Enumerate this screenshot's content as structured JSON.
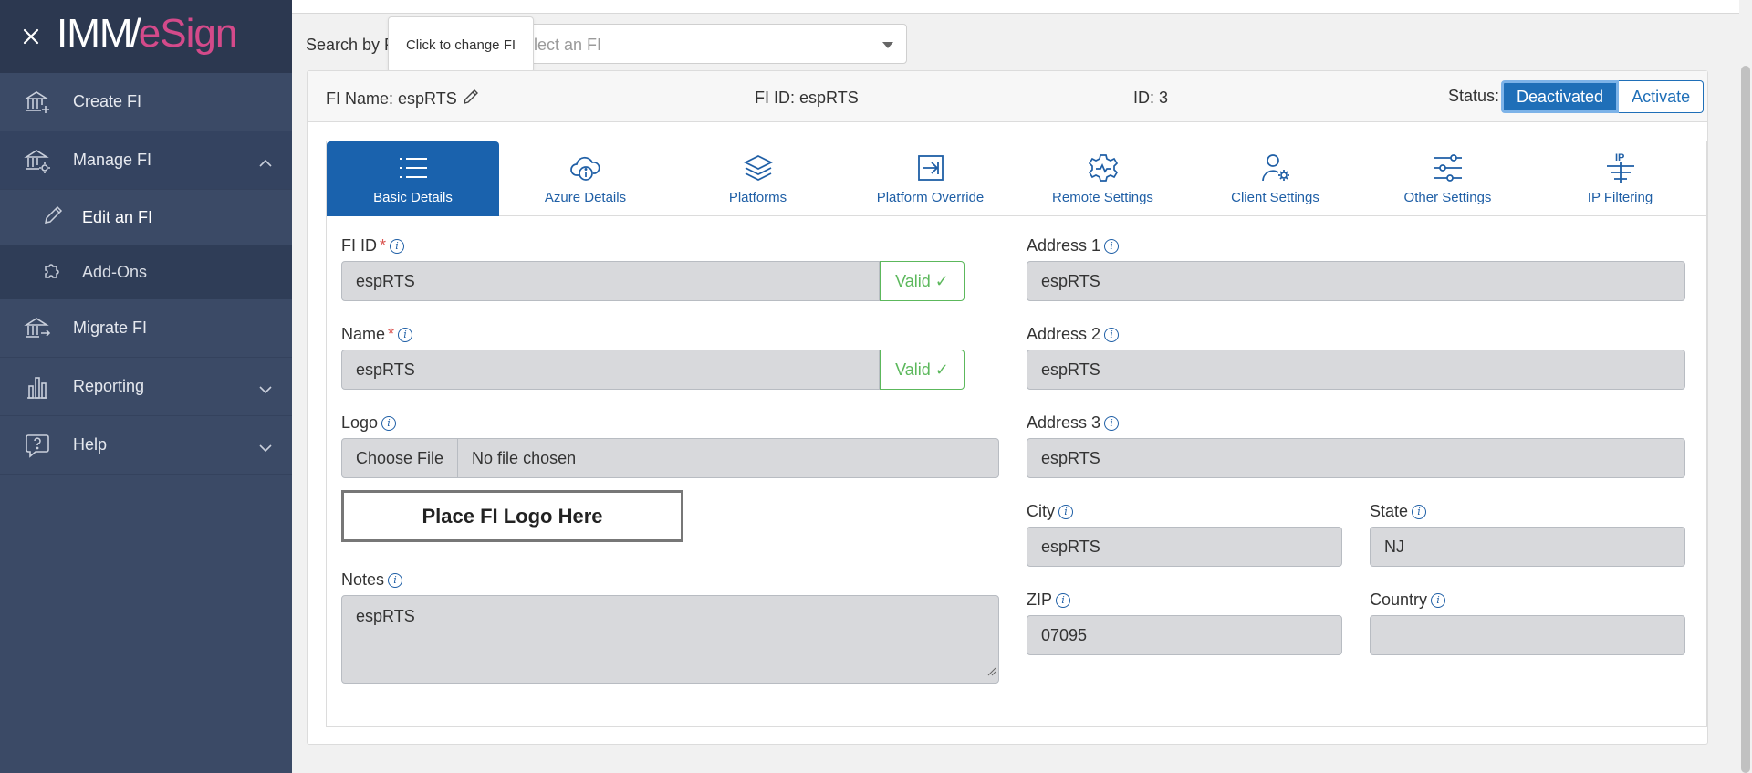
{
  "sidebar": {
    "logo": {
      "part1": "IMM",
      "part2": "/",
      "part3": "eSign"
    },
    "items": [
      {
        "label": "Create FI",
        "icon": "bank-plus-icon"
      },
      {
        "label": "Manage FI",
        "icon": "bank-gear-icon"
      },
      {
        "label": "Migrate FI",
        "icon": "bank-arrow-icon"
      },
      {
        "label": "Reporting",
        "icon": "bar-chart-icon"
      },
      {
        "label": "Help",
        "icon": "help-bubble-icon"
      }
    ],
    "sub_items": [
      {
        "label": "Edit an FI",
        "icon": "pencil-icon"
      },
      {
        "label": "Add-Ons",
        "icon": "puzzle-icon"
      }
    ]
  },
  "search": {
    "label": "Search by F",
    "placeholder": "elect an FI",
    "tooltip": "Click to change FI"
  },
  "header": {
    "fi_name": "FI Name: espRTS",
    "fi_id": "FI ID: espRTS",
    "id": "ID: 3",
    "status_label": "Status:",
    "status_options": [
      "Deactivated",
      "Activate"
    ]
  },
  "tabs": [
    {
      "label": "Basic Details",
      "icon": "list-icon",
      "active": true
    },
    {
      "label": "Azure Details",
      "icon": "cloud-info-icon"
    },
    {
      "label": "Platforms",
      "icon": "layers-icon"
    },
    {
      "label": "Platform Override",
      "icon": "arrow-box-icon"
    },
    {
      "label": "Remote Settings",
      "icon": "gear-pulse-icon"
    },
    {
      "label": "Client Settings",
      "icon": "user-gear-icon"
    },
    {
      "label": "Other Settings",
      "icon": "sliders-icon"
    },
    {
      "label": "IP Filtering",
      "icon": "ip-filter-icon"
    }
  ],
  "form": {
    "fi_id": {
      "label": "FI ID",
      "value": "espRTS",
      "valid": "Valid ✓"
    },
    "name": {
      "label": "Name",
      "value": "espRTS",
      "valid": "Valid ✓"
    },
    "logo": {
      "label": "Logo",
      "choose": "Choose File",
      "chosen": "No file chosen",
      "placeholder": "Place FI Logo Here"
    },
    "notes": {
      "label": "Notes",
      "value": "espRTS"
    },
    "address1": {
      "label": "Address 1",
      "value": "espRTS"
    },
    "address2": {
      "label": "Address 2",
      "value": "espRTS"
    },
    "address3": {
      "label": "Address 3",
      "value": "espRTS"
    },
    "city": {
      "label": "City",
      "value": "espRTS"
    },
    "state": {
      "label": "State",
      "value": "NJ"
    },
    "zip": {
      "label": "ZIP",
      "value": "07095"
    },
    "country": {
      "label": "Country",
      "value": ""
    }
  },
  "colors": {
    "sidebar": "#3b4a66",
    "accent": "#1a62ad",
    "valid": "#5cb85c",
    "brand_pink": "#d44a8a"
  }
}
